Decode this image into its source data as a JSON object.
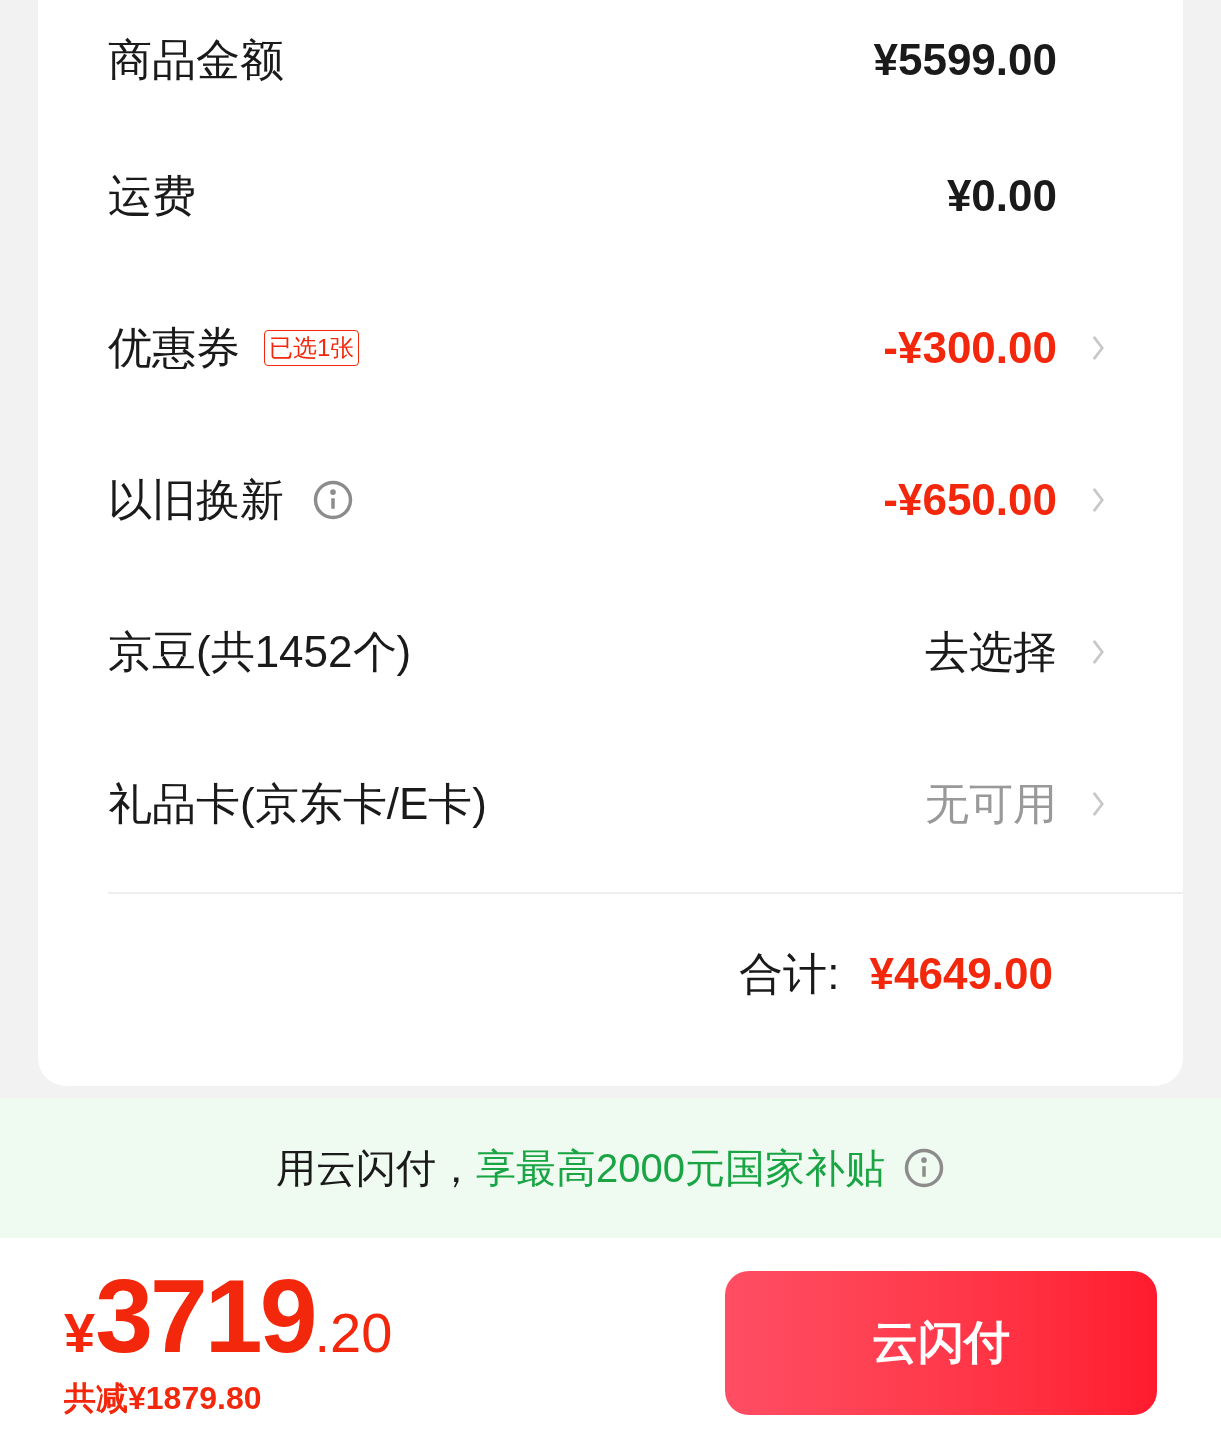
{
  "summary": {
    "rows": [
      {
        "label": "商品金额",
        "value": "¥5599.00",
        "kind": "normal",
        "arrow": false
      },
      {
        "label": "运费",
        "value": "¥0.00",
        "kind": "normal",
        "arrow": false
      },
      {
        "label": "优惠券",
        "badge": "已选1张",
        "value": "-¥300.00",
        "kind": "discount",
        "arrow": true
      },
      {
        "label": "以旧换新",
        "info": true,
        "value": "-¥650.00",
        "kind": "discount",
        "arrow": true
      },
      {
        "label": "京豆(共1452个)",
        "value": "去选择",
        "kind": "option",
        "arrow": true
      },
      {
        "label": "礼品卡(京东卡/E卡)",
        "value": "无可用",
        "kind": "muted",
        "arrow": true
      }
    ],
    "total": {
      "label": "合计:",
      "value": "¥4649.00"
    }
  },
  "banner": {
    "text": "用云闪付，",
    "highlight": "享最高2000元国家补贴"
  },
  "footer": {
    "currency": "¥",
    "integer": "3719",
    "decimal": ".20",
    "saved": "共减¥1879.80",
    "pay_button": "云闪付"
  }
}
